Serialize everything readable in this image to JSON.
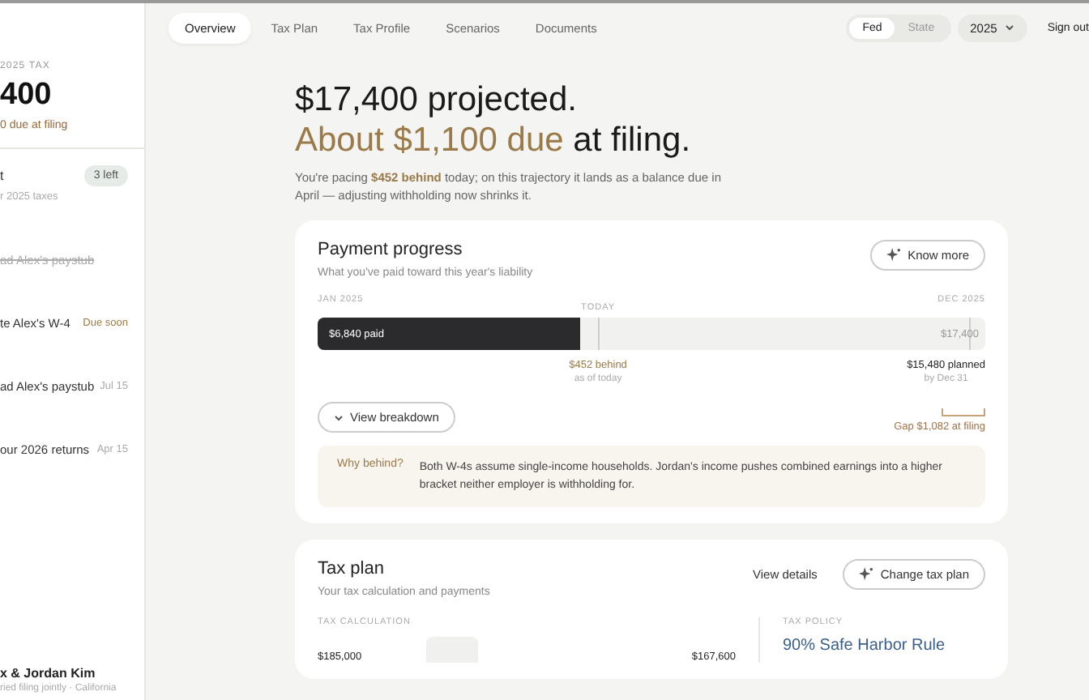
{
  "sidebar": {
    "summary": {
      "label": "2025 TAX",
      "amount": "400",
      "note": "0 due at filing"
    },
    "checklist": {
      "title": "t",
      "badge": "3 left",
      "subtitle": "r 2025 taxes",
      "items": [
        {
          "label": "ad Alex's paystub",
          "done": true
        },
        {
          "label": "te Alex's W-4",
          "done": false,
          "tag": "Due soon",
          "kind": "alert"
        },
        {
          "label": "ad Alex's paystub",
          "done": false,
          "tag": "Jul 15",
          "kind": "date"
        },
        {
          "label": "our 2026 returns",
          "done": false,
          "tag": "Apr 15",
          "kind": "date"
        }
      ]
    },
    "profile": {
      "name": "x & Jordan Kim",
      "detail": "ried filing jointly · California"
    }
  },
  "nav": {
    "tabs": [
      {
        "label": "Overview",
        "selected": true
      },
      {
        "label": "Tax Plan",
        "selected": false
      },
      {
        "label": "Tax Profile",
        "selected": false
      },
      {
        "label": "Scenarios",
        "selected": false
      },
      {
        "label": "Documents",
        "selected": false
      }
    ],
    "scope": [
      {
        "label": "Fed",
        "selected": true
      },
      {
        "label": "State",
        "selected": false
      }
    ],
    "year": "2025",
    "sign_out": "Sign out"
  },
  "hero": {
    "line1": "$17,400 projected.",
    "line2": "**About $1,100 due** at filing.",
    "body": "You're pacing **$452 behind** today; on this trajectory it lands as a balance due in April — adjusting withholding now shrinks it."
  },
  "payment_progress": {
    "title": "Payment progress",
    "subtitle": "What you've paid toward this year's liability",
    "action": "Know more",
    "start": "JAN 2025",
    "today": "TODAY",
    "end": "DEC 2025",
    "paid": "$6,840 paid",
    "level": 0.393,
    "total": "$17,400",
    "behind": "$452 behind",
    "behind_note": "as of today",
    "planned": "$15,480 planned",
    "planned_note": "by Dec 31",
    "gap": "Gap $1,082 at filing",
    "breakdown": "View breakdown",
    "why_label": "Why behind?",
    "why_text": "Both W-4s assume single-income households. Jordan's income pushes combined earnings into a higher bracket neither employer is withholding for."
  },
  "tax_plan": {
    "title": "Tax plan",
    "subtitle": "Your tax calculation and payments",
    "details": "View details",
    "action": "Change tax plan",
    "calc_label": "TAX CALCULATION",
    "calc_left": "$185,000",
    "calc_right": "$167,600",
    "policy_label": "TAX POLICY",
    "policy_title": "90% Safe Harbor Rule"
  }
}
